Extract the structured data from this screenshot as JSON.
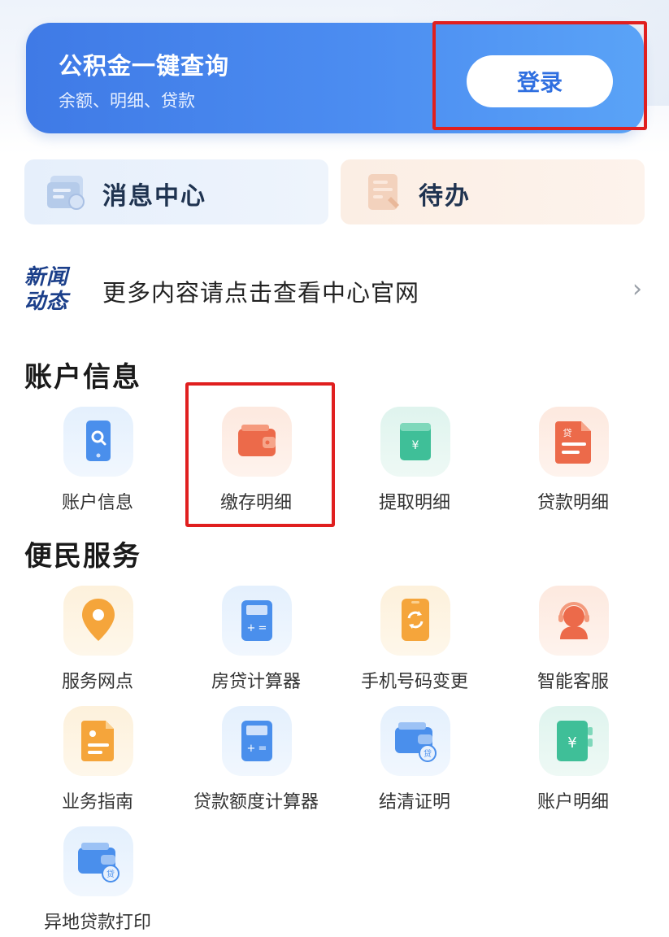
{
  "banner": {
    "title": "公积金一键查询",
    "subtitle": "余额、明细、贷款",
    "login_label": "登录"
  },
  "quick": {
    "messages_label": "消息中心",
    "todo_label": "待办"
  },
  "news": {
    "badge_line1": "新闻",
    "badge_line2": "动态",
    "text": "更多内容请点击查看中心官网",
    "arrow": "›"
  },
  "account_section": {
    "title": "账户信息",
    "items": [
      {
        "label": "账户信息",
        "icon": "phone-search-icon"
      },
      {
        "label": "缴存明细",
        "icon": "wallet-icon"
      },
      {
        "label": "提取明细",
        "icon": "yuan-card-icon"
      },
      {
        "label": "贷款明细",
        "icon": "loan-document-icon"
      }
    ]
  },
  "service_section": {
    "title": "便民服务",
    "items": [
      {
        "label": "服务网点",
        "icon": "location-pin-icon"
      },
      {
        "label": "房贷计算器",
        "icon": "calculator-icon"
      },
      {
        "label": "手机号码变更",
        "icon": "phone-swap-icon"
      },
      {
        "label": "智能客服",
        "icon": "customer-service-icon"
      },
      {
        "label": "业务指南",
        "icon": "guide-document-icon"
      },
      {
        "label": "贷款额度计算器",
        "icon": "calculator-icon"
      },
      {
        "label": "结清证明",
        "icon": "wallet-loan-icon"
      },
      {
        "label": "账户明细",
        "icon": "yuan-book-icon"
      },
      {
        "label": "异地贷款打印",
        "icon": "wallet-loan-icon"
      }
    ]
  },
  "colors": {
    "banner": "#4c8df1",
    "highlight": "#e01f1f",
    "text_dark": "#1a1a1a"
  }
}
